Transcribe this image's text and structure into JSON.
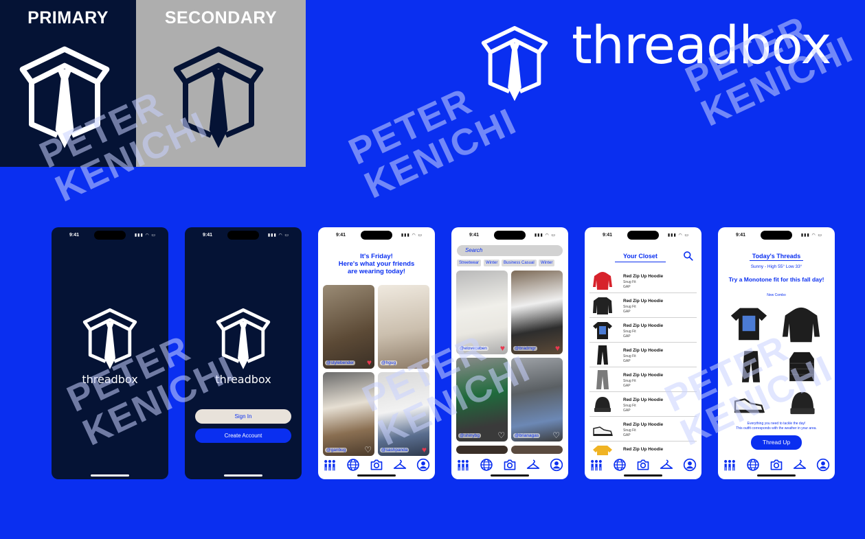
{
  "colors": {
    "brand_blue": "#0a2ff0",
    "navy": "#051335",
    "gray": "#aeaeae",
    "white": "#ffffff"
  },
  "labels": {
    "primary": "PRIMARY",
    "secondary": "SECONDARY"
  },
  "brand": {
    "name": "threadbox"
  },
  "watermark": {
    "line1": "PETER",
    "line2": "KENICHI"
  },
  "status": {
    "time": "9:41",
    "signal": "▮▮▮ ◠ ▭"
  },
  "auth": {
    "app_name": "threadbox",
    "sign_in": "Sign In",
    "create_account": "Create Account"
  },
  "feed": {
    "heading_line1": "It's Friday!",
    "heading_line2": "Here's what your friends",
    "heading_line3": "are wearing today!",
    "posts": [
      {
        "handle": "@stylebender",
        "liked": true
      },
      {
        "handle": "@hgug",
        "liked": false
      },
      {
        "handle": "@ganbug",
        "liked": false
      },
      {
        "handle": "@sashpanda",
        "liked": true
      }
    ]
  },
  "explore": {
    "search_placeholder": "Search",
    "chips": [
      "Streetwear",
      "Winter",
      "Business Casual",
      "Winter"
    ],
    "posts": [
      {
        "handle": "@eloveceben",
        "liked": true
      },
      {
        "handle": "@bradmgr",
        "liked": true
      },
      {
        "handle": "@shinybg",
        "liked": false
      },
      {
        "handle": "@brianagas",
        "liked": false
      }
    ]
  },
  "closet": {
    "title": "Your Closet",
    "items": [
      {
        "name": "Red Zip Up Hoodie",
        "fit": "Snug Fit",
        "brand": "GAP"
      },
      {
        "name": "Red Zip Up Hoodie",
        "fit": "Snug Fit",
        "brand": "GAP"
      },
      {
        "name": "Red Zip Up Hoodie",
        "fit": "Snug Fit",
        "brand": "GAP"
      },
      {
        "name": "Red Zip Up Hoodie",
        "fit": "Snug Fit",
        "brand": "GAP"
      },
      {
        "name": "Red Zip Up Hoodie",
        "fit": "Snug Fit",
        "brand": "GAP"
      },
      {
        "name": "Red Zip Up Hoodie",
        "fit": "Snug Fit",
        "brand": "GAP"
      },
      {
        "name": "Red Zip Up Hoodie",
        "fit": "Snug Fit",
        "brand": "GAP"
      },
      {
        "name": "Red Zip Up Hoodie",
        "fit": "",
        "brand": ""
      }
    ]
  },
  "threads": {
    "title": "Today's Threads",
    "weather": "Sunny - High 55° Low 33°",
    "pitch": "Try a Monotone fit for this fall day!",
    "sub": "New Combo",
    "foot_line1": "Everything you need to tackle the day!",
    "foot_line2": "This outfit corresponds with the weather in your area.",
    "button": "Thread Up"
  }
}
